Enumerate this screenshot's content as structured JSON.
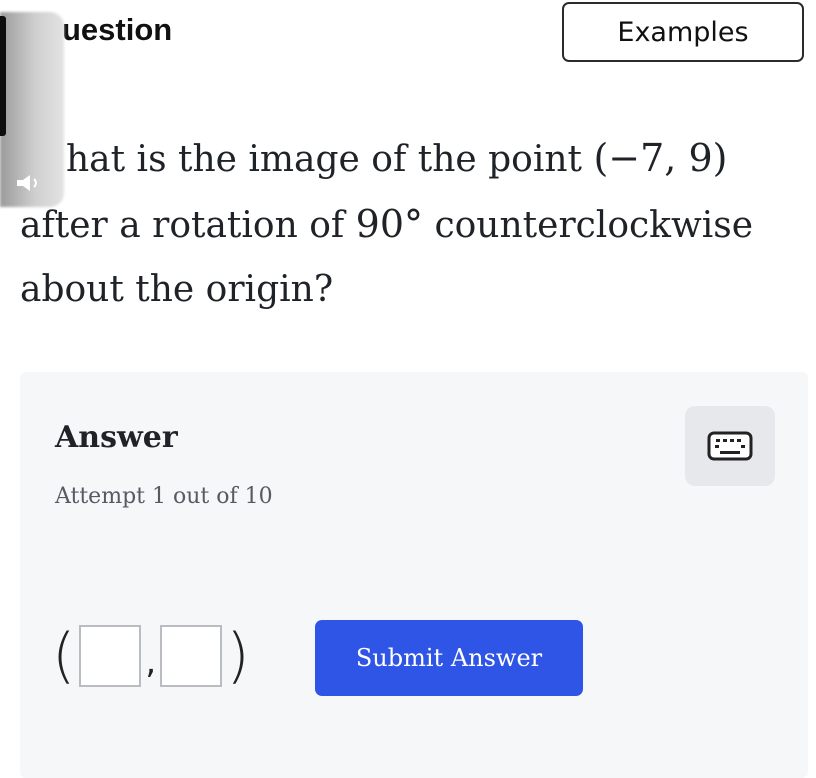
{
  "header": {
    "title": "uestion",
    "examples_label": "Examples"
  },
  "question": {
    "line1_start": "hat is the image of the point ",
    "point": "(−7, 9)",
    "line2_start": "after a rotation of ",
    "angle": "90°",
    "line2_end": " counterclockwise",
    "line3": "about the origin?"
  },
  "answer": {
    "heading": "Answer",
    "attempt": "Attempt 1 out of 10",
    "open_paren": "(",
    "comma": ",",
    "close_paren": ")",
    "submit_label": "Submit Answer"
  },
  "icons": {
    "speaker": "speaker-icon",
    "keyboard": "keyboard-icon"
  },
  "colors": {
    "submit_bg": "#2f55e6",
    "panel_bg": "#f6f7f9"
  }
}
